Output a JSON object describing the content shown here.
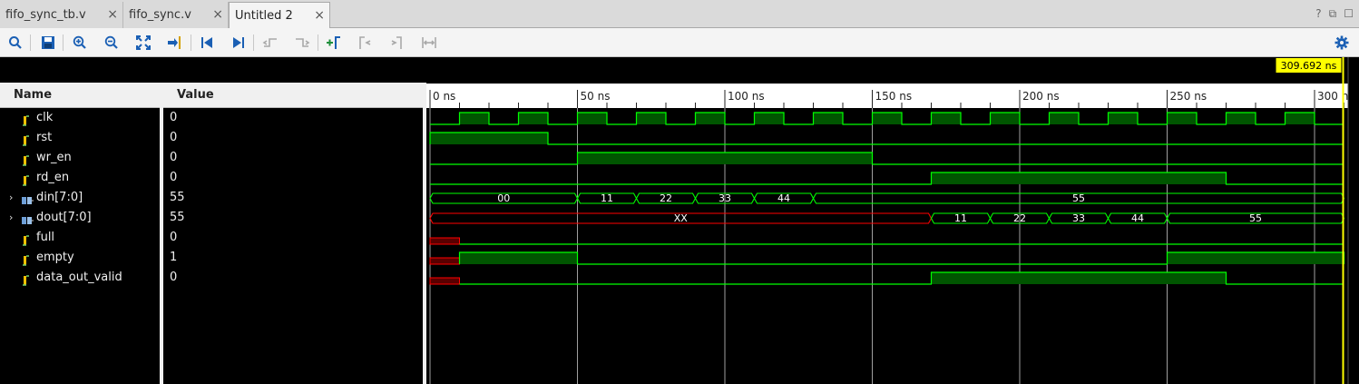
{
  "tabs": [
    {
      "label": "fifo_sync_tb.v",
      "close": "×",
      "active": false
    },
    {
      "label": "fifo_sync.v",
      "close": "×",
      "active": false
    },
    {
      "label": "Untitled 2",
      "close": "×",
      "active": true
    }
  ],
  "tab_actions": {
    "help": "?",
    "restore": "⧉",
    "maximize": "☐"
  },
  "toolbar": {
    "icons": [
      "search-icon",
      "save-icon",
      "zoom-in-icon",
      "zoom-out-icon",
      "zoom-fit-icon",
      "goto-cursor-icon",
      "goto-start-icon",
      "goto-end-icon",
      "previous-transition-icon",
      "next-transition-icon",
      "add-marker-icon",
      "previous-marker-icon",
      "next-marker-icon",
      "swap-cursors-icon",
      "settings-gear-icon"
    ],
    "accent_blue": "#1a5fb4"
  },
  "waveform": {
    "headers": {
      "name": "Name",
      "value": "Value"
    },
    "cursor_label": "309.692 ns",
    "time_ticks": [
      "0 ns",
      "50 ns",
      "100 ns",
      "150 ns",
      "200 ns",
      "250 ns",
      "300 ns"
    ],
    "colors": {
      "signal": "#00ff00",
      "fill": "#005500",
      "undefined": "#ff0000",
      "undefined_fill": "#5a0000",
      "cursor": "#ffff00",
      "grid": "#c8c8c8"
    },
    "signals": [
      {
        "name": "clk",
        "value": "0",
        "type": "bit",
        "expandable": false
      },
      {
        "name": "rst",
        "value": "0",
        "type": "bit",
        "expandable": false
      },
      {
        "name": "wr_en",
        "value": "0",
        "type": "bit",
        "expandable": false
      },
      {
        "name": "rd_en",
        "value": "0",
        "type": "bit",
        "expandable": false
      },
      {
        "name": "din[7:0]",
        "value": "55",
        "type": "bus",
        "expandable": true
      },
      {
        "name": "dout[7:0]",
        "value": "55",
        "type": "bus",
        "expandable": true
      },
      {
        "name": "full",
        "value": "0",
        "type": "bit",
        "expandable": false
      },
      {
        "name": "empty",
        "value": "1",
        "type": "bit",
        "expandable": false
      },
      {
        "name": "data_out_valid",
        "value": "0",
        "type": "bit",
        "expandable": false
      }
    ],
    "din_segments": [
      {
        "start": 0,
        "end": 50,
        "label": "00"
      },
      {
        "start": 50,
        "end": 70,
        "label": "11"
      },
      {
        "start": 70,
        "end": 90,
        "label": "22"
      },
      {
        "start": 90,
        "end": 110,
        "label": "33"
      },
      {
        "start": 110,
        "end": 130,
        "label": "44"
      },
      {
        "start": 130,
        "end": 310,
        "label": "55"
      }
    ],
    "dout_segments": [
      {
        "start": 0,
        "end": 170,
        "label": "XX",
        "undefined": true
      },
      {
        "start": 170,
        "end": 190,
        "label": "11"
      },
      {
        "start": 190,
        "end": 210,
        "label": "22"
      },
      {
        "start": 210,
        "end": 230,
        "label": "33"
      },
      {
        "start": 230,
        "end": 250,
        "label": "44"
      },
      {
        "start": 250,
        "end": 310,
        "label": "55"
      }
    ],
    "bit_waves": {
      "clk": {
        "undef_until": 0,
        "high": [
          [
            10,
            20
          ],
          [
            30,
            40
          ],
          [
            50,
            60
          ],
          [
            70,
            80
          ],
          [
            90,
            100
          ],
          [
            110,
            120
          ],
          [
            130,
            140
          ],
          [
            150,
            160
          ],
          [
            170,
            180
          ],
          [
            190,
            200
          ],
          [
            210,
            220
          ],
          [
            230,
            240
          ],
          [
            250,
            260
          ],
          [
            270,
            280
          ],
          [
            290,
            300
          ]
        ]
      },
      "rst": {
        "undef_until": 0,
        "high": [
          [
            0,
            40
          ]
        ]
      },
      "wr_en": {
        "undef_until": 0,
        "high": [
          [
            50,
            150
          ]
        ]
      },
      "rd_en": {
        "undef_until": 0,
        "high": [
          [
            170,
            270
          ]
        ]
      },
      "full": {
        "undef_until": 10,
        "high": []
      },
      "empty": {
        "undef_until": 10,
        "high": [
          [
            10,
            50
          ],
          [
            250,
            310
          ]
        ]
      },
      "data_out_valid": {
        "undef_until": 10,
        "high": [
          [
            170,
            270
          ]
        ]
      }
    },
    "time_range_ns": [
      0,
      310
    ],
    "cursor_ns": 309.692
  }
}
